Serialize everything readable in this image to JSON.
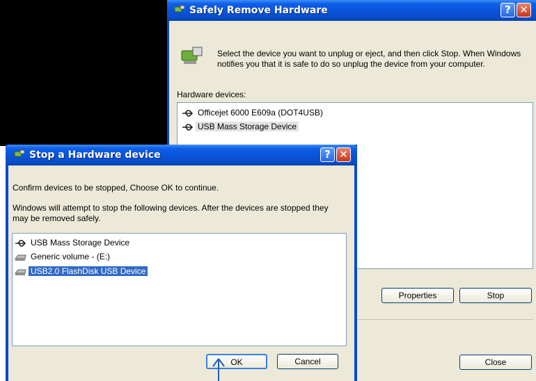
{
  "main_window": {
    "title": "Safely Remove Hardware",
    "help_label": "?",
    "close_label": "✕",
    "instruction": "Select the device you want to unplug or eject, and then click Stop. When Windows notifies you that it is safe to do so unplug the device from your computer.",
    "devices_label": "Hardware devices:",
    "devices": [
      {
        "label": "Officejet 6000 E609a (DOT4USB)",
        "icon": "usb-icon"
      },
      {
        "label": "USB Mass Storage Device",
        "icon": "usb-icon"
      }
    ],
    "properties_label": "Properties",
    "stop_label": "Stop",
    "close_button_label": "Close"
  },
  "stop_dialog": {
    "title": "Stop a Hardware device",
    "help_label": "?",
    "close_label": "✕",
    "confirm_text": "Confirm devices to be stopped, Choose OK to continue.",
    "info_text": "Windows will attempt to stop the following devices. After the devices are stopped they may be removed safely.",
    "devices": [
      {
        "label": "USB Mass Storage Device",
        "icon": "usb-icon"
      },
      {
        "label": "Generic volume - (E:)",
        "icon": "drive-icon"
      },
      {
        "label": "USB2.0 FlashDisk USB Device",
        "icon": "drive-icon"
      }
    ],
    "ok_label": "OK",
    "cancel_label": "Cancel"
  },
  "colors": {
    "titlebar": "#0a4cc8",
    "selection": "#316ac5",
    "dialog_bg": "#ece9d8"
  }
}
